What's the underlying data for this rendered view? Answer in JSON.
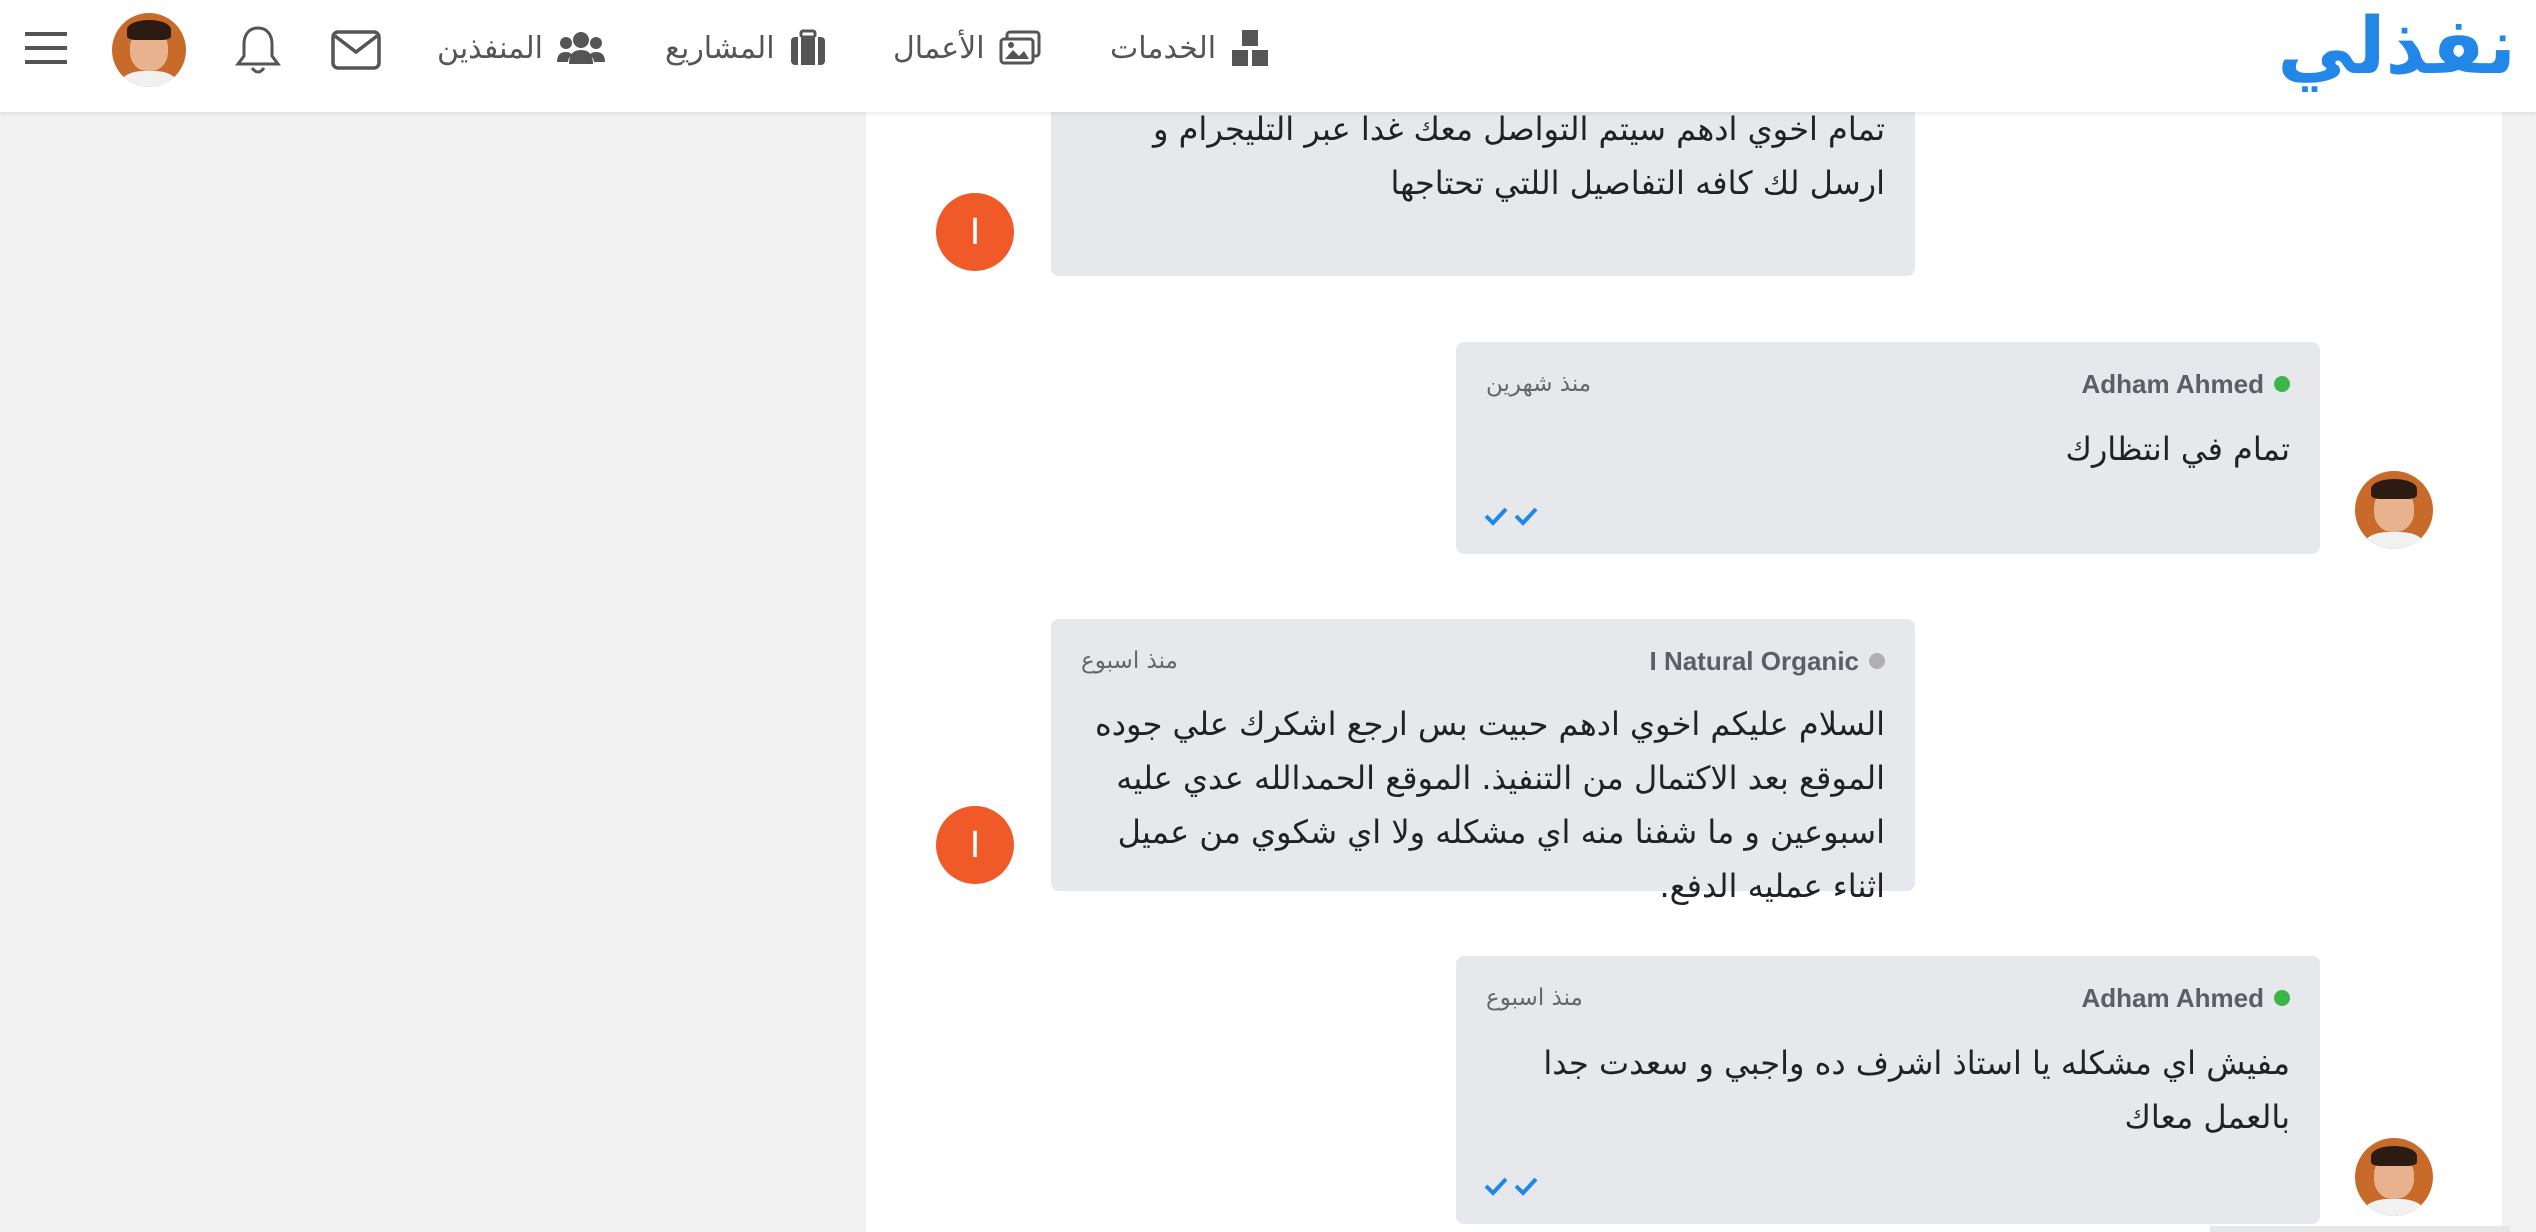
{
  "header": {
    "logo": "نفذلي",
    "nav": {
      "services": "الخدمات",
      "works": "الأعمال",
      "projects": "المشاريع",
      "freelancers": "المنفذين"
    },
    "icons": [
      "services-icon",
      "works-icon",
      "projects-icon",
      "freelancers-icon",
      "envelope-icon",
      "bell-icon",
      "hamburger-menu-icon"
    ]
  },
  "messages": [
    {
      "sender": "",
      "avatar_letter": "I",
      "text": "تمام اخوي ادهم سيتم التواصل معك غدا عبر التليجرام و ارسل لك كافه التفاصيل اللتي تحتاجها"
    },
    {
      "sender": "Adham Ahmed",
      "status": "online",
      "time": "منذ شهرين",
      "text": "تمام في انتظارك",
      "read": true
    },
    {
      "sender": "I Natural Organic",
      "status": "offline",
      "avatar_letter": "I",
      "time": "منذ اسبوع",
      "text": "السلام عليكم اخوي ادهم حبيت بس ارجع اشكرك علي جوده الموقع بعد الاكتمال من التنفيذ. الموقع الحمدالله عدي عليه اسبوعين و ما شفنا منه اي مشكله ولا اي شكوي من عميل اثناء عمليه الدفع."
    },
    {
      "sender": "Adham Ahmed",
      "status": "online",
      "time": "منذ اسبوع",
      "text": "مفيش اي مشكله يا استاذ اشرف ده واجبي و سعدت جدا بالعمل معاك",
      "read": true
    }
  ],
  "colors": {
    "brand": "#2387e8",
    "bubble": "#e6e8ec",
    "online": "#3cb54a",
    "offline": "#b0b0b0",
    "letter_avatar": "#f05a28",
    "read_ticks": "#1e88e5"
  }
}
